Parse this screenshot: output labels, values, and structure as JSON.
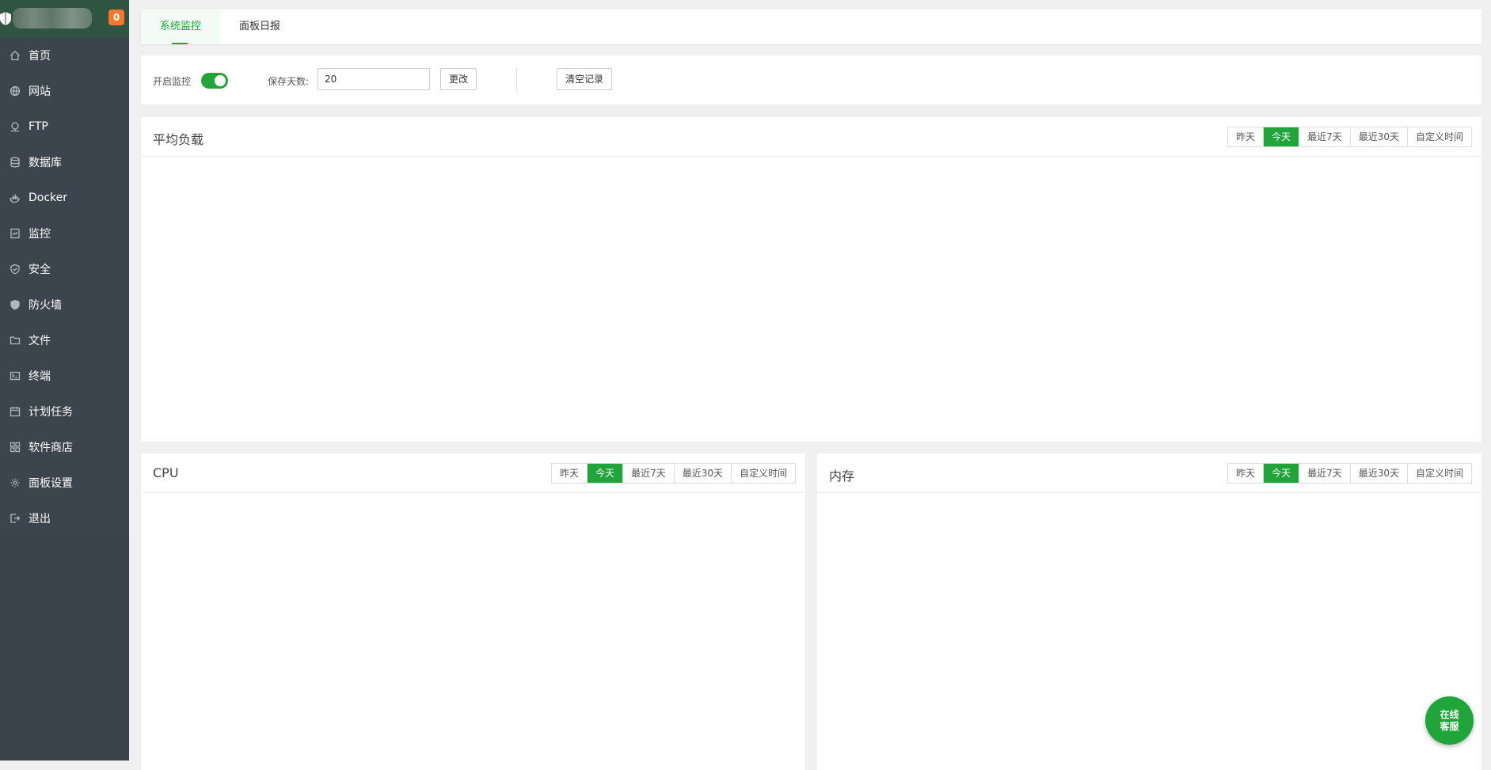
{
  "sidebar": {
    "badge": "0",
    "items": [
      {
        "label": "首页",
        "icon": "home-icon"
      },
      {
        "label": "网站",
        "icon": "globe-icon"
      },
      {
        "label": "FTP",
        "icon": "ftp-icon"
      },
      {
        "label": "数据库",
        "icon": "database-icon"
      },
      {
        "label": "Docker",
        "icon": "docker-icon"
      },
      {
        "label": "监控",
        "icon": "monitor-icon"
      },
      {
        "label": "安全",
        "icon": "shield-icon"
      },
      {
        "label": "防火墙",
        "icon": "firewall-icon"
      },
      {
        "label": "文件",
        "icon": "folder-icon"
      },
      {
        "label": "终端",
        "icon": "terminal-icon"
      },
      {
        "label": "计划任务",
        "icon": "calendar-icon"
      },
      {
        "label": "软件商店",
        "icon": "grid-icon"
      },
      {
        "label": "面板设置",
        "icon": "gear-icon"
      },
      {
        "label": "退出",
        "icon": "logout-icon"
      }
    ]
  },
  "tabs": [
    {
      "label": "系统监控",
      "active": true
    },
    {
      "label": "面板日报",
      "active": false
    }
  ],
  "controls": {
    "monitor_label": "开启监控",
    "monitor_enabled": true,
    "days_label": "保存天数:",
    "days_value": "20",
    "change_button": "更改",
    "clear_button": "清空记录"
  },
  "ranges": [
    "昨天",
    "今天",
    "最近7天",
    "最近30天",
    "自定义时间"
  ],
  "active_range": "今天",
  "panels": {
    "load_title": "平均负载",
    "cpu_title": "CPU",
    "memory_title": "内存"
  },
  "chat": {
    "line1": "在线",
    "line2": "客服"
  },
  "colors": {
    "accent": "#20a53a",
    "sidebar": "#3c444d",
    "badge": "#f7782b"
  }
}
